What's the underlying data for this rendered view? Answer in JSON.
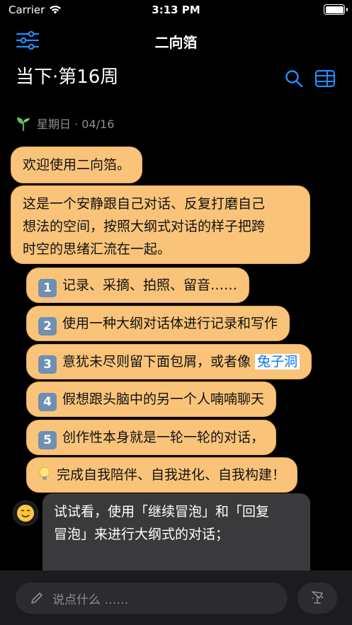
{
  "status": {
    "carrier": "Carrier",
    "time": "3:13 PM"
  },
  "nav": {
    "title": "二向箔"
  },
  "week_title": "当下·第16周",
  "date_label": "星期日 · 04/16",
  "messages": {
    "welcome": "欢迎使用二向箔。",
    "intro_line1": "这是一个安静跟自己对话、反复打磨自己",
    "intro_line2": "想法的空间，按照大纲式对话的样子把跨",
    "intro_line3": "时空的思绪汇流在一起。",
    "items": [
      {
        "num": "1",
        "text": "记录、采摘、拍照、留音……"
      },
      {
        "num": "2",
        "text": "使用一种大纲对话体进行记录和写作"
      },
      {
        "num": "3",
        "text": "意犹未尽则留下面包屑，或者像",
        "link": "兔子洞"
      },
      {
        "num": "4",
        "text": "假想跟头脑中的另一个人喃喃聊天"
      },
      {
        "num": "5",
        "text": "创作性本身就是一轮一轮的对话，"
      }
    ],
    "tip": "完成自我陪伴、自我进化、自我构建！",
    "user_line1": "试试看，使用「继续冒泡」和「回复",
    "user_line2": "冒泡」来进行大纲式的对话；"
  },
  "input": {
    "placeholder": "说点什么 ……"
  },
  "colors": {
    "bubble": "#f9c47a",
    "accent": "#1e90ff",
    "number_badge": "#6f8fb3",
    "user_bubble": "#3a3a3c"
  },
  "icons": {
    "menu": "sliders-icon",
    "search": "search-icon",
    "layout": "layout-icon",
    "sprout": "sprout-icon",
    "bulb": "lightbulb-icon",
    "avatar": "smiley-icon",
    "pencil": "pencil-icon",
    "send": "send-icon"
  }
}
